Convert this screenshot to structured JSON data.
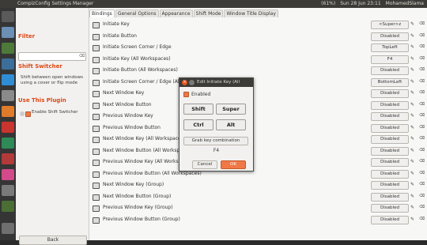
{
  "topbar": {
    "window_title": "CompizConfig Settings Manager",
    "indicators": [
      "(61%)",
      "Sun 28 Jun 23:11",
      "MohamedSlama"
    ]
  },
  "sidebar": {
    "filter_heading": "Filter",
    "search_value": "",
    "shift_switcher_heading": "Shift Switcher",
    "description": "Shift between open windows using a cover or flip mode",
    "use_plugin_heading": "Use This Plugin",
    "enable_label": "Enable Shift Switcher",
    "back_label": "Back"
  },
  "tabs": [
    "Bindings",
    "General Options",
    "Appearance",
    "Shift Mode",
    "Window Title Display"
  ],
  "bindings": [
    {
      "label": "Initiate Key",
      "value": "<Super>z"
    },
    {
      "label": "Initiate Button",
      "value": "Disabled"
    },
    {
      "label": "Initiate Screen Corner / Edge",
      "value": "TopLeft"
    },
    {
      "label": "Initiate Key (All Workspaces)",
      "value": "F4"
    },
    {
      "label": "Initiate Button (All Workspaces)",
      "value": "Disabled"
    },
    {
      "label": "Initiate Screen Corner / Edge (All Workspaces)",
      "value": "BottomLeft"
    },
    {
      "label": "Next Window Key",
      "value": "Disabled"
    },
    {
      "label": "Next Window Button",
      "value": "Disabled"
    },
    {
      "label": "Previous Window Key",
      "value": "Disabled"
    },
    {
      "label": "Previous Window Button",
      "value": "Disabled"
    },
    {
      "label": "Next Window Key (All Workspaces)",
      "value": "Disabled"
    },
    {
      "label": "Next Window Button (All Workspaces)",
      "value": "Disabled"
    },
    {
      "label": "Previous Window Key (All Workspaces)",
      "value": "Disabled"
    },
    {
      "label": "Previous Window Button (All Workspaces)",
      "value": "Disabled"
    },
    {
      "label": "Next Window Key (Group)",
      "value": "Disabled"
    },
    {
      "label": "Next Window Button (Group)",
      "value": "Disabled"
    },
    {
      "label": "Previous Window Key (Group)",
      "value": "Disabled"
    },
    {
      "label": "Previous Window Button (Group)",
      "value": "Disabled"
    }
  ],
  "dialog": {
    "title": "Edit Initiate Key (All",
    "enabled_label": "Enabled",
    "shift": "Shift",
    "super": "Super",
    "ctrl": "Ctrl",
    "alt": "Alt",
    "grab_label": "Grab key combination",
    "key": "F4",
    "cancel_label": "Cancel",
    "ok_label": "OK"
  },
  "colors": {
    "accent": "#f07746",
    "topbar": "#3c3b37",
    "heading": "#dd4814"
  }
}
